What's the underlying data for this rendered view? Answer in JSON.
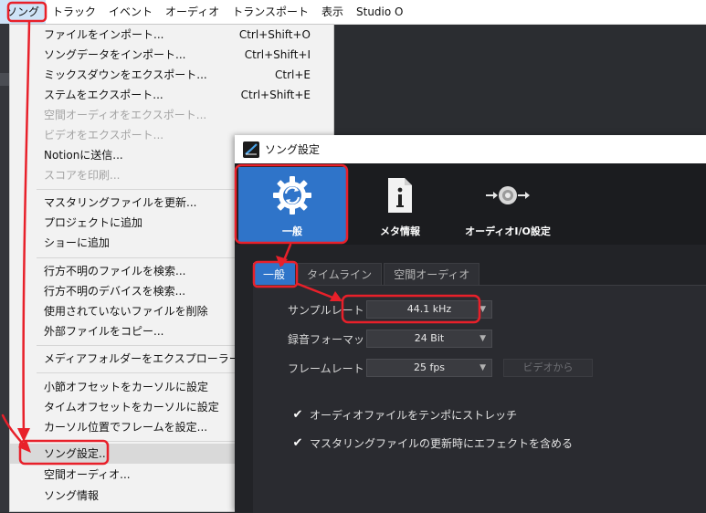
{
  "menubar": {
    "items": [
      "ソング",
      "トラック",
      "イベント",
      "オーディオ",
      "トランスポート",
      "表示",
      "Studio O"
    ]
  },
  "song_menu": {
    "items": [
      {
        "label": "ファイルをインポート...",
        "shortcut": "Ctrl+Shift+O"
      },
      {
        "label": "ソングデータをインポート...",
        "shortcut": "Ctrl+Shift+I"
      },
      {
        "label": "ミックスダウンをエクスポート...",
        "shortcut": "Ctrl+E"
      },
      {
        "label": "ステムをエクスポート...",
        "shortcut": "Ctrl+Shift+E"
      },
      {
        "label": "空間オーディオをエクスポート...",
        "shortcut": ""
      },
      {
        "label": "ビデオをエクスポート...",
        "shortcut": ""
      },
      {
        "label": "Notionに送信...",
        "shortcut": ""
      },
      {
        "label": "スコアを印刷...",
        "shortcut": ""
      },
      {
        "label": "マスタリングファイルを更新...",
        "shortcut": ""
      },
      {
        "label": "プロジェクトに追加",
        "shortcut": ""
      },
      {
        "label": "ショーに追加",
        "shortcut": ""
      },
      {
        "label": "行方不明のファイルを検索...",
        "shortcut": ""
      },
      {
        "label": "行方不明のデバイスを検索...",
        "shortcut": ""
      },
      {
        "label": "使用されていないファイルを削除",
        "shortcut": ""
      },
      {
        "label": "外部ファイルをコピー...",
        "shortcut": ""
      },
      {
        "label": "メディアフォルダーをエクスプローラーに表示",
        "shortcut": ""
      },
      {
        "label": "小節オフセットをカーソルに設定",
        "shortcut": ""
      },
      {
        "label": "タイムオフセットをカーソルに設定",
        "shortcut": ""
      },
      {
        "label": "カーソル位置でフレームを設定...",
        "shortcut": ""
      },
      {
        "label": "ソング設定...",
        "shortcut": ""
      },
      {
        "label": "空間オーディオ...",
        "shortcut": ""
      },
      {
        "label": "ソング情報",
        "shortcut": ""
      }
    ]
  },
  "dialog": {
    "title": "ソング設定",
    "toolbar": {
      "general": "一般",
      "meta": "メタ情報",
      "audio_io": "オーディオI/O設定"
    },
    "tabs": [
      "一般",
      "タイムライン",
      "空間オーディオ"
    ],
    "sample_rate": {
      "label": "サンプルレート",
      "value": "44.1 kHz"
    },
    "record_format": {
      "label": "録音フォーマット",
      "value": "24 Bit"
    },
    "frame_rate": {
      "label": "フレームレート",
      "value": "25 fps",
      "from_video": "ビデオから"
    },
    "checkboxes": [
      {
        "label": "オーディオファイルをテンポにストレッチ",
        "checked": true
      },
      {
        "label": "マスタリングファイルの更新時にエフェクトを含める",
        "checked": true
      }
    ]
  },
  "annotation_color": "#e8202a"
}
